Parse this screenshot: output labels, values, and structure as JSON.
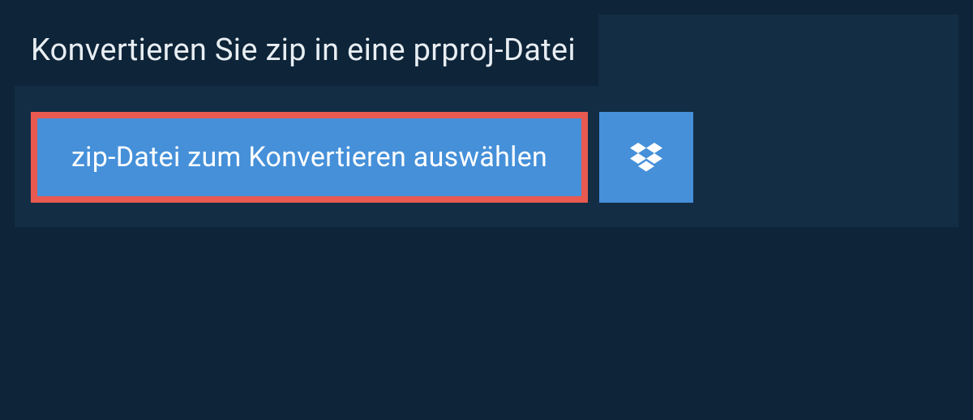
{
  "header": {
    "title": "Konvertieren Sie zip in eine prproj-Datei"
  },
  "actions": {
    "select_file_label": "zip-Datei zum Konvertieren auswählen"
  },
  "colors": {
    "page_bg": "#0e2438",
    "panel_bg": "#132d44",
    "button_bg": "#4590d9",
    "highlight_border": "#e85a4f",
    "text_primary": "#ffffff",
    "text_heading": "#e8eef3"
  }
}
